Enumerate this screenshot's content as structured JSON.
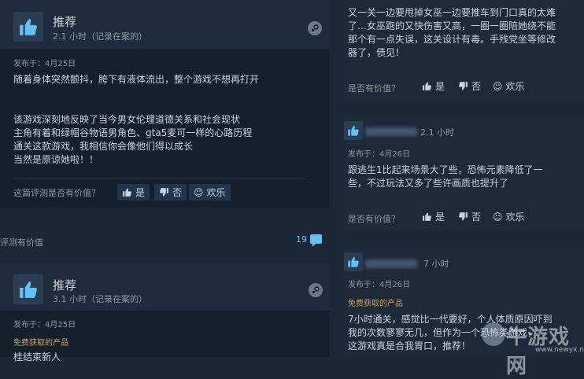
{
  "colors": {
    "bg": "#1b2838",
    "accent": "#66c0f4",
    "free_label": "#d4a055"
  },
  "left_reviews": [
    {
      "title": "推荐",
      "hours": "2.1 小时（记录在案的）",
      "posted": "发布于：4月25日",
      "lines": [
        "随着身体突然颤抖，胯下有液体流出，整个游戏不想再打开",
        "",
        "",
        "该游戏深刻地反映了当今男女伦理道德关系和社会现状",
        "主角有着和绿帽谷物语男角色、gta5麦可一样的心路历程",
        "通关这款游戏，我相信你会像他们得以成长",
        "当然是原谅她啦！！"
      ],
      "helpful_question": "这篇评测是否有价值？",
      "yes": "是",
      "no": "否",
      "funny": "欢乐"
    },
    {
      "title": "推荐",
      "hours": "3.1 小时（记录在案的）",
      "posted": "发布于：4月25日",
      "free_label": "免费获取的产品",
      "partial_line": "桂结束新人"
    }
  ],
  "community_helpful": "评测有价值",
  "comment_count": "19",
  "right_reviews": [
    {
      "lines": [
        "又一关一边要甩掉女巫一边要推车到门口真的太难",
        "了…女巫跑的又快伤害又高，一圈一圈陪她绕不能",
        "那个有一点失误，这关设计有毒。手残党坐等修改",
        "器了，债见！"
      ],
      "helpful_question": "是否有价值？",
      "yes": "是",
      "no": "否",
      "funny": "欢乐"
    },
    {
      "hours": "2.1 小时",
      "posted": "发布于：4月26日",
      "lines": [
        "跟逃生1比起来场景大了些，恐怖元素降低了一",
        "些，不过玩法又多了些许画质也提升了"
      ],
      "helpful_question": "是否有价值？",
      "yes": "是",
      "no": "否",
      "funny": "欢乐"
    },
    {
      "hours": "7 小时",
      "posted": "发布于：4月26日",
      "free_label": "免费获取的产品",
      "lines": [
        "7小时通关，感觉比一代要好，个人体质原因吓到",
        "我的次数寥寥无几，但作为一个恐怖类游戏，",
        "这游戏真是合我胃口，推荐！"
      ]
    }
  ],
  "watermark": {
    "name": "牛游戏网",
    "url": "www.newyx.net"
  }
}
